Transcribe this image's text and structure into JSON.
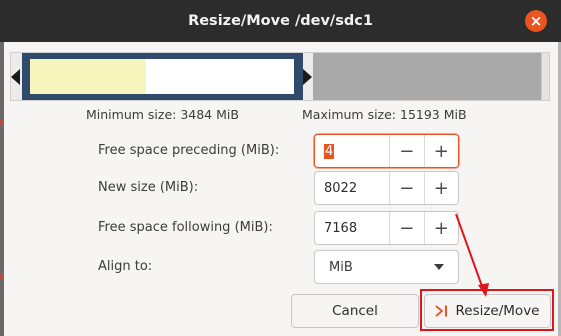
{
  "dialog": {
    "title": "Resize/Move /dev/sdc1"
  },
  "partition_bar": {
    "used_fraction": 0.44
  },
  "sizes": {
    "minimum": "Minimum size: 3484 MiB",
    "maximum": "Maximum size: 15193 MiB"
  },
  "fields": {
    "free_preceding": {
      "label": "Free space preceding (MiB):",
      "value": "4"
    },
    "new_size": {
      "label": "New size (MiB):",
      "value": "8022"
    },
    "free_following": {
      "label": "Free space following (MiB):",
      "value": "7168"
    },
    "align_to": {
      "label": "Align to:",
      "value": "MiB"
    }
  },
  "buttons": {
    "cancel": "Cancel",
    "resize_move": "Resize/Move",
    "minus": "−",
    "plus": "+",
    "close": "×"
  },
  "colors": {
    "accent": "#e95420",
    "annotation": "#e0141c",
    "partition_border": "#2f4a6b",
    "used_space": "#f8f5bc"
  }
}
